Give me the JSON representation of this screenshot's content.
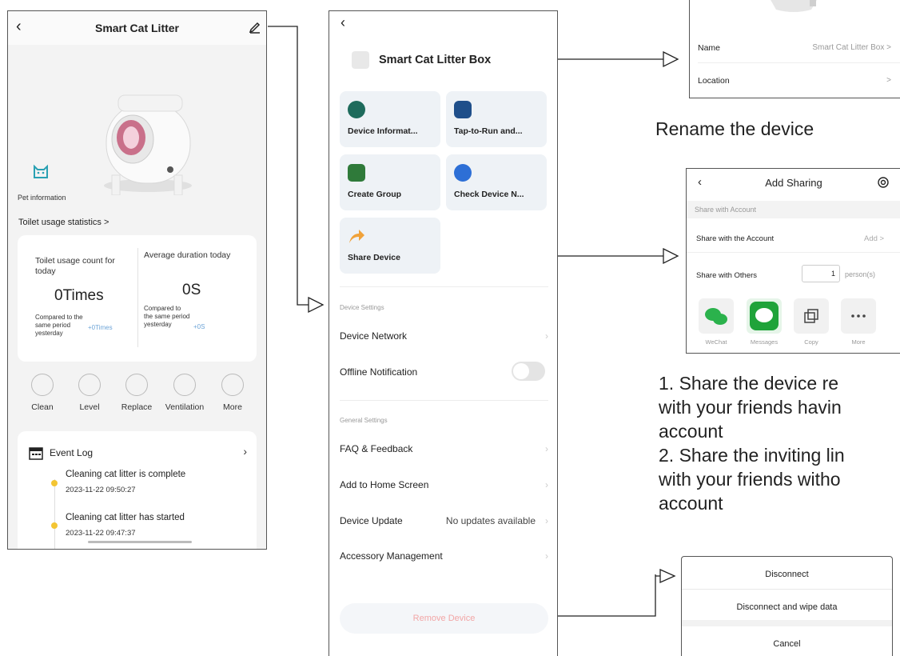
{
  "panel1": {
    "title": "Smart Cat Litter",
    "back_icon": "chevron-left-icon",
    "edit_icon": "edit-icon",
    "pet_info_label": "Pet information",
    "stats_link": "Toilet usage statistics >",
    "stats": {
      "count_label": "Toilet usage count for today",
      "count_value": "0Times",
      "count_compare": "Compared to the same period yesterday",
      "count_delta": "+0Times",
      "duration_label": "Average duration today",
      "duration_value": "0S",
      "duration_compare": "Compared to the same period yesterday",
      "duration_delta": "+0S"
    },
    "actions": [
      {
        "label": "Clean",
        "icon": "clean-icon"
      },
      {
        "label": "Level",
        "icon": "level-icon"
      },
      {
        "label": "Replace",
        "icon": "replace-icon"
      },
      {
        "label": "Ventilation",
        "icon": "ventilation-icon"
      },
      {
        "label": "More",
        "icon": "more-icon"
      }
    ],
    "event_log": {
      "title": "Event Log",
      "events": [
        {
          "text": "Cleaning cat litter is complete",
          "time": "2023-11-22 09:50:27"
        },
        {
          "text": "Cleaning cat litter has started",
          "time": "2023-11-22 09:47:37"
        }
      ]
    }
  },
  "panel2": {
    "device_name": "Smart Cat Litter Box",
    "tiles": [
      {
        "label": "Device Informat...",
        "icon": "info-icon",
        "color": "#1e6b5c"
      },
      {
        "label": "Tap-to-Run and...",
        "icon": "automation-icon",
        "color": "#1f4f8a"
      },
      {
        "label": "Create Group",
        "icon": "create-group-icon",
        "color": "#2f7a3a"
      },
      {
        "label": "Check Device N...",
        "icon": "network-check-icon",
        "color": "#2d6fd6"
      },
      {
        "label": "Share Device",
        "icon": "share-icon",
        "color": "#f0a23a"
      }
    ],
    "device_settings_header": "Device Settings",
    "device_network": "Device Network",
    "offline_notification": "Offline Notification",
    "general_settings_header": "General Settings",
    "faq": "FAQ & Feedback",
    "add_home": "Add to Home Screen",
    "device_update": "Device Update",
    "device_update_value": "No updates available",
    "accessory": "Accessory Management",
    "remove_device": "Remove Device"
  },
  "panel3": {
    "name_label": "Name",
    "name_value": "Smart Cat Litter Box >",
    "location_label": "Location",
    "location_value": ">"
  },
  "caption_rename": "Rename the device",
  "panel4": {
    "title": "Add Sharing",
    "section": "Share with Account",
    "share_account": "Share with the Account",
    "add": "Add >",
    "share_others": "Share with Others",
    "count": "1",
    "persons": "person(s)",
    "share_options": [
      {
        "label": "WeChat",
        "icon": "wechat-icon"
      },
      {
        "label": "Messages",
        "icon": "messages-icon"
      },
      {
        "label": "Copy",
        "icon": "copy-icon"
      },
      {
        "label": "More",
        "icon": "more-icon"
      }
    ]
  },
  "caption_share": [
    "1. Share the device re",
    "with your friends havin",
    "account",
    "2. Share the inviting lin",
    "with your friends witho",
    "account"
  ],
  "panel5": {
    "disconnect": "Disconnect",
    "disconnect_wipe": "Disconnect and wipe data",
    "cancel": "Cancel"
  }
}
